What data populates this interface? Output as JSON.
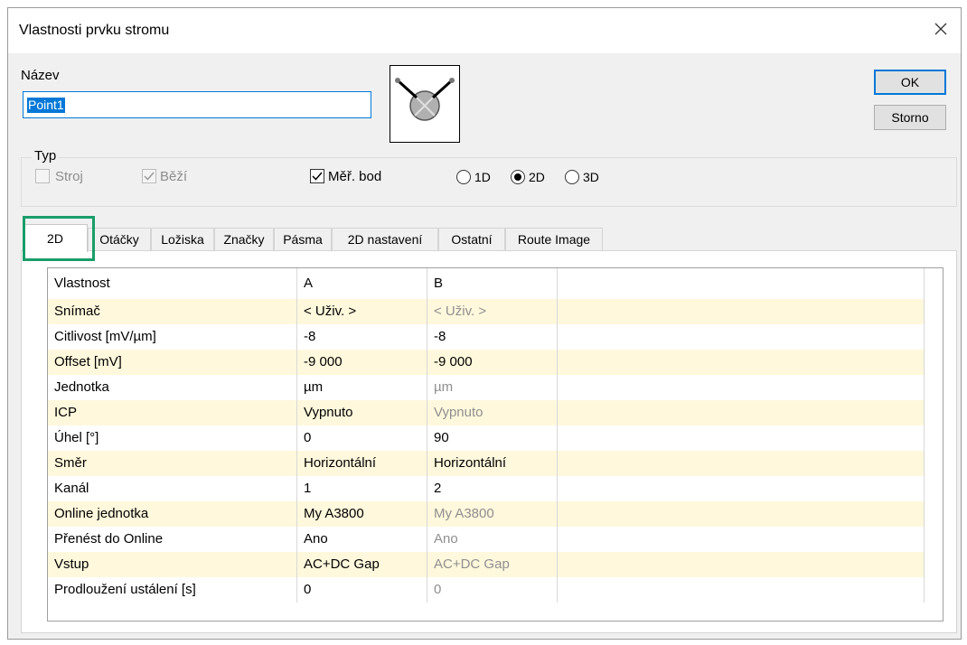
{
  "window": {
    "title": "Vlastnosti prvku stromu"
  },
  "name_field": {
    "label": "Název",
    "value": "Point1"
  },
  "buttons": {
    "ok": "OK",
    "cancel": "Storno"
  },
  "type_group": {
    "label": "Typ",
    "stroj": {
      "label": "Stroj",
      "checked": false,
      "enabled": false
    },
    "bezi": {
      "label": "Běží",
      "checked": true,
      "enabled": false
    },
    "mer_bod": {
      "label": "Měř. bod",
      "checked": true,
      "enabled": true
    },
    "dims": [
      {
        "label": "1D",
        "selected": false
      },
      {
        "label": "2D",
        "selected": true
      },
      {
        "label": "3D",
        "selected": false
      }
    ]
  },
  "tabs": [
    {
      "label": "2D",
      "active": true
    },
    {
      "label": "Otáčky"
    },
    {
      "label": "Ložiska"
    },
    {
      "label": "Značky"
    },
    {
      "label": "Pásma"
    },
    {
      "label": "2D nastavení"
    },
    {
      "label": "Ostatní"
    },
    {
      "label": "Route Image"
    }
  ],
  "grid": {
    "headers": [
      "Vlastnost",
      "A",
      "B"
    ],
    "rows": [
      [
        "Snímač",
        "< Uživ. >",
        "< Uživ. >"
      ],
      [
        "Citlivost [mV/µm]",
        "-8",
        "-8"
      ],
      [
        "Offset [mV]",
        "-9 000",
        "-9 000"
      ],
      [
        "Jednotka",
        "µm",
        "µm"
      ],
      [
        "ICP",
        "Vypnuto",
        "Vypnuto"
      ],
      [
        "Úhel [°]",
        "0",
        "90"
      ],
      [
        "Směr",
        "Horizontální",
        "Horizontální"
      ],
      [
        "Kanál",
        "1",
        "2"
      ],
      [
        "Online jednotka",
        "My A3800",
        "My A3800"
      ],
      [
        "Přenést do Online",
        "Ano",
        "Ano"
      ],
      [
        "Vstup",
        "AC+DC Gap",
        "AC+DC Gap"
      ],
      [
        "Prodloužení ustálení [s]",
        "0",
        "0"
      ]
    ],
    "b_greyed_rows": [
      0,
      3,
      4,
      8,
      9,
      10,
      11
    ]
  },
  "colors": {
    "accent": "#0078d7",
    "row_highlight": "#fff8dc",
    "annotation": "#1a9e6a"
  }
}
